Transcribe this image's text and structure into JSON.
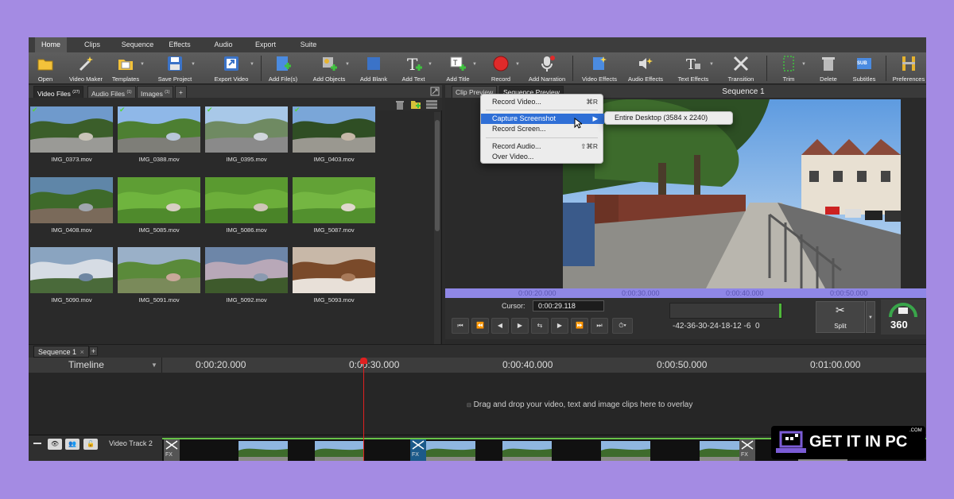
{
  "menu": {
    "tabs": [
      "Home",
      "Clips",
      "Sequence",
      "Effects",
      "Audio",
      "Export",
      "Suite"
    ],
    "active": 0
  },
  "toolbar": {
    "buttons": [
      "Open",
      "Video Maker",
      "Templates",
      "Save Project",
      "Export Video",
      "Add File(s)",
      "Add Objects",
      "Add Blank",
      "Add Text",
      "Add Title",
      "Record",
      "Add Narration",
      "Video Effects",
      "Audio Effects",
      "Text Effects",
      "Transition",
      "Trim",
      "Delete",
      "Subtitles",
      "Preferences"
    ],
    "subtitles_badge": "SUB"
  },
  "media": {
    "tabs": [
      {
        "label": "Video Files",
        "count": "(27)"
      },
      {
        "label": "Audio Files",
        "count": "(1)"
      },
      {
        "label": "Images",
        "count": "(1)"
      }
    ],
    "add_tab": "+",
    "items": [
      {
        "name": "IMG_0373.mov",
        "checked": true,
        "scene": "street"
      },
      {
        "name": "IMG_0388.mov",
        "checked": true,
        "scene": "field-road"
      },
      {
        "name": "IMG_0395.mov",
        "checked": true,
        "scene": "harbour"
      },
      {
        "name": "IMG_0403.mov",
        "checked": true,
        "scene": "street-trees"
      },
      {
        "name": "IMG_0408.mov",
        "checked": false,
        "scene": "garden"
      },
      {
        "name": "IMG_5085.mov",
        "checked": false,
        "scene": "grass-animal"
      },
      {
        "name": "IMG_5086.mov",
        "checked": false,
        "scene": "grass-animal2"
      },
      {
        "name": "IMG_5087.mov",
        "checked": false,
        "scene": "grass-animal3"
      },
      {
        "name": "IMG_5090.mov",
        "checked": false,
        "scene": "clouds"
      },
      {
        "name": "IMG_5091.mov",
        "checked": false,
        "scene": "horse"
      },
      {
        "name": "IMG_5092.mov",
        "checked": false,
        "scene": "sky-hill"
      },
      {
        "name": "IMG_5093.mov",
        "checked": false,
        "scene": "horse-close"
      }
    ]
  },
  "preview": {
    "tabs": [
      "Clip Preview",
      "Sequence Preview"
    ],
    "title": "Sequence 1",
    "ruler": [
      "0:00:20.000",
      "0:00:30.000",
      "0:00:40.000",
      "0:00:50.000"
    ],
    "cursor_label": "Cursor:",
    "cursor_value": "0:00:29.118",
    "meter_scale": "-42-36-30-24-18-12 -6  0",
    "split_label": "Split",
    "badge_360": "360"
  },
  "context_menu": {
    "items": [
      {
        "label": "Record Video...",
        "shortcut": "⌘R"
      },
      {
        "label": "Capture Screenshot",
        "shortcut": "▶",
        "selected": true
      },
      {
        "label": "Record Screen...",
        "shortcut": ""
      },
      {
        "label": "Record Audio...",
        "shortcut": "⇧⌘R"
      },
      {
        "label": "Over Video...",
        "shortcut": ""
      }
    ],
    "submenu": "Entire Desktop (3584 x 2240)"
  },
  "timeline": {
    "sequence_tab": "Sequence 1",
    "close": "×",
    "add": "+",
    "label": "Timeline",
    "ruler": [
      "0:00:20.000",
      "0:00:30.000",
      "0:00:40.000",
      "0:00:50.000",
      "0:01:00.000"
    ],
    "drop_hint": "Drag and drop your video, text and image clips here to overlay",
    "track_name": "Video Track 2",
    "fx_label": "FX"
  },
  "watermark": {
    "text": "GET IT IN PC",
    "suffix": ".COM"
  },
  "colors": {
    "background": "#a48be3",
    "menu_selected": "#2f6fd6",
    "ruler": "#8f87e6",
    "playhead": "#e02020",
    "track_accent": "#67c248",
    "check": "#58d23a"
  }
}
